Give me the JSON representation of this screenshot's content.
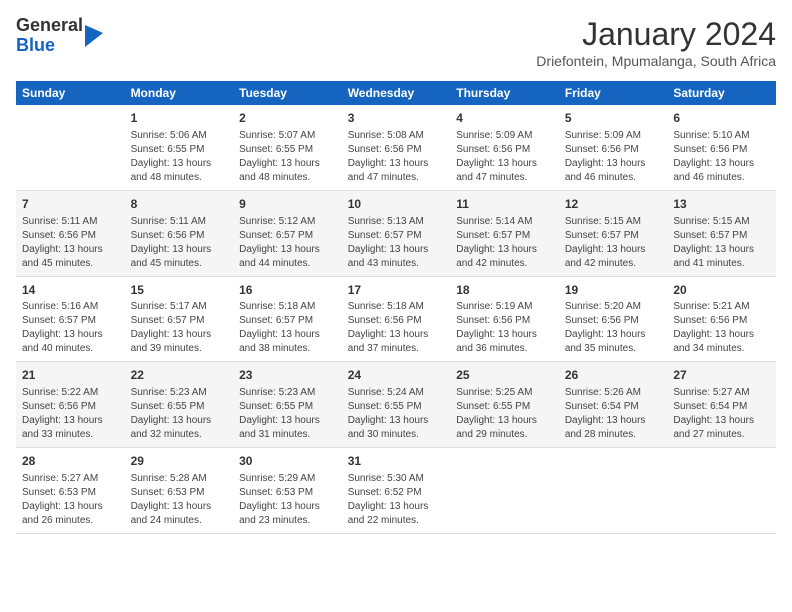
{
  "header": {
    "logo_general": "General",
    "logo_blue": "Blue",
    "month": "January 2024",
    "location": "Driefontein, Mpumalanga, South Africa"
  },
  "days_of_week": [
    "Sunday",
    "Monday",
    "Tuesday",
    "Wednesday",
    "Thursday",
    "Friday",
    "Saturday"
  ],
  "weeks": [
    [
      {
        "day": "",
        "text": ""
      },
      {
        "day": "1",
        "text": "Sunrise: 5:06 AM\nSunset: 6:55 PM\nDaylight: 13 hours and 48 minutes."
      },
      {
        "day": "2",
        "text": "Sunrise: 5:07 AM\nSunset: 6:55 PM\nDaylight: 13 hours and 48 minutes."
      },
      {
        "day": "3",
        "text": "Sunrise: 5:08 AM\nSunset: 6:56 PM\nDaylight: 13 hours and 47 minutes."
      },
      {
        "day": "4",
        "text": "Sunrise: 5:09 AM\nSunset: 6:56 PM\nDaylight: 13 hours and 47 minutes."
      },
      {
        "day": "5",
        "text": "Sunrise: 5:09 AM\nSunset: 6:56 PM\nDaylight: 13 hours and 46 minutes."
      },
      {
        "day": "6",
        "text": "Sunrise: 5:10 AM\nSunset: 6:56 PM\nDaylight: 13 hours and 46 minutes."
      }
    ],
    [
      {
        "day": "7",
        "text": "Sunrise: 5:11 AM\nSunset: 6:56 PM\nDaylight: 13 hours and 45 minutes."
      },
      {
        "day": "8",
        "text": "Sunrise: 5:11 AM\nSunset: 6:56 PM\nDaylight: 13 hours and 45 minutes."
      },
      {
        "day": "9",
        "text": "Sunrise: 5:12 AM\nSunset: 6:57 PM\nDaylight: 13 hours and 44 minutes."
      },
      {
        "day": "10",
        "text": "Sunrise: 5:13 AM\nSunset: 6:57 PM\nDaylight: 13 hours and 43 minutes."
      },
      {
        "day": "11",
        "text": "Sunrise: 5:14 AM\nSunset: 6:57 PM\nDaylight: 13 hours and 42 minutes."
      },
      {
        "day": "12",
        "text": "Sunrise: 5:15 AM\nSunset: 6:57 PM\nDaylight: 13 hours and 42 minutes."
      },
      {
        "day": "13",
        "text": "Sunrise: 5:15 AM\nSunset: 6:57 PM\nDaylight: 13 hours and 41 minutes."
      }
    ],
    [
      {
        "day": "14",
        "text": "Sunrise: 5:16 AM\nSunset: 6:57 PM\nDaylight: 13 hours and 40 minutes."
      },
      {
        "day": "15",
        "text": "Sunrise: 5:17 AM\nSunset: 6:57 PM\nDaylight: 13 hours and 39 minutes."
      },
      {
        "day": "16",
        "text": "Sunrise: 5:18 AM\nSunset: 6:57 PM\nDaylight: 13 hours and 38 minutes."
      },
      {
        "day": "17",
        "text": "Sunrise: 5:18 AM\nSunset: 6:56 PM\nDaylight: 13 hours and 37 minutes."
      },
      {
        "day": "18",
        "text": "Sunrise: 5:19 AM\nSunset: 6:56 PM\nDaylight: 13 hours and 36 minutes."
      },
      {
        "day": "19",
        "text": "Sunrise: 5:20 AM\nSunset: 6:56 PM\nDaylight: 13 hours and 35 minutes."
      },
      {
        "day": "20",
        "text": "Sunrise: 5:21 AM\nSunset: 6:56 PM\nDaylight: 13 hours and 34 minutes."
      }
    ],
    [
      {
        "day": "21",
        "text": "Sunrise: 5:22 AM\nSunset: 6:56 PM\nDaylight: 13 hours and 33 minutes."
      },
      {
        "day": "22",
        "text": "Sunrise: 5:23 AM\nSunset: 6:55 PM\nDaylight: 13 hours and 32 minutes."
      },
      {
        "day": "23",
        "text": "Sunrise: 5:23 AM\nSunset: 6:55 PM\nDaylight: 13 hours and 31 minutes."
      },
      {
        "day": "24",
        "text": "Sunrise: 5:24 AM\nSunset: 6:55 PM\nDaylight: 13 hours and 30 minutes."
      },
      {
        "day": "25",
        "text": "Sunrise: 5:25 AM\nSunset: 6:55 PM\nDaylight: 13 hours and 29 minutes."
      },
      {
        "day": "26",
        "text": "Sunrise: 5:26 AM\nSunset: 6:54 PM\nDaylight: 13 hours and 28 minutes."
      },
      {
        "day": "27",
        "text": "Sunrise: 5:27 AM\nSunset: 6:54 PM\nDaylight: 13 hours and 27 minutes."
      }
    ],
    [
      {
        "day": "28",
        "text": "Sunrise: 5:27 AM\nSunset: 6:53 PM\nDaylight: 13 hours and 26 minutes."
      },
      {
        "day": "29",
        "text": "Sunrise: 5:28 AM\nSunset: 6:53 PM\nDaylight: 13 hours and 24 minutes."
      },
      {
        "day": "30",
        "text": "Sunrise: 5:29 AM\nSunset: 6:53 PM\nDaylight: 13 hours and 23 minutes."
      },
      {
        "day": "31",
        "text": "Sunrise: 5:30 AM\nSunset: 6:52 PM\nDaylight: 13 hours and 22 minutes."
      },
      {
        "day": "",
        "text": ""
      },
      {
        "day": "",
        "text": ""
      },
      {
        "day": "",
        "text": ""
      }
    ]
  ]
}
